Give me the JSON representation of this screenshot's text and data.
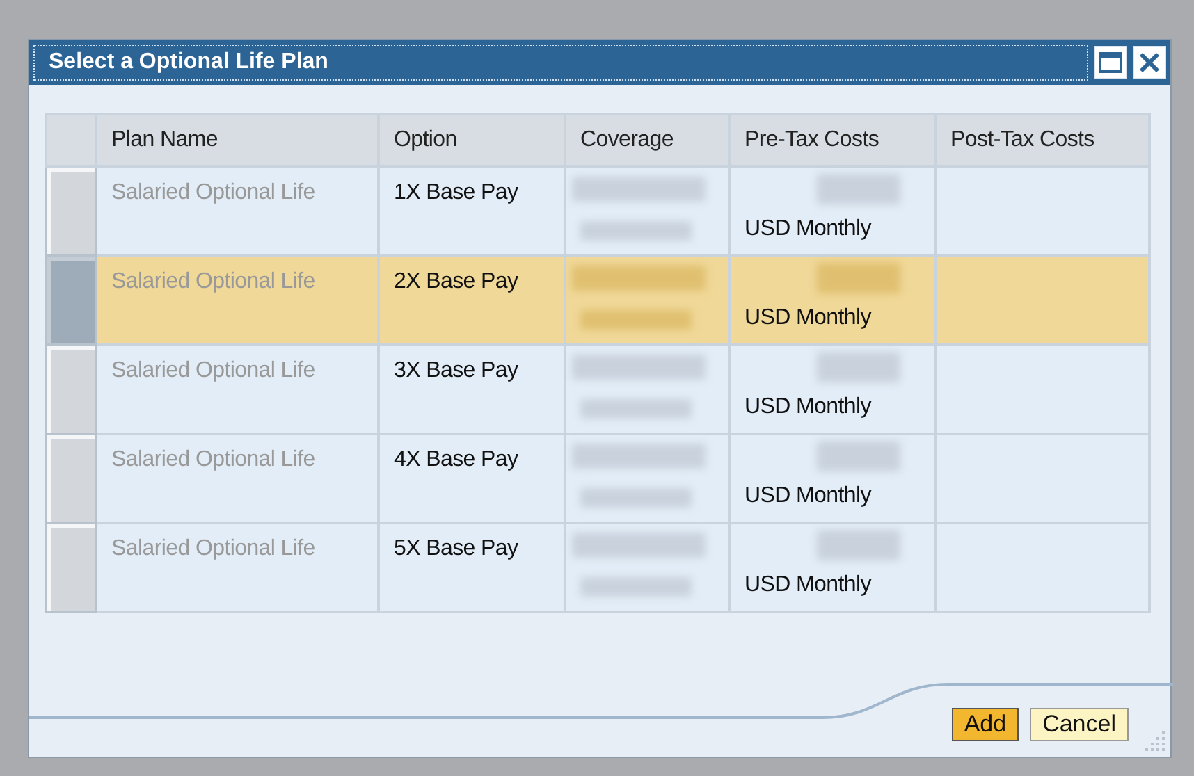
{
  "window": {
    "title": "Select a Optional Life Plan"
  },
  "table": {
    "columns": [
      "Plan Name",
      "Option",
      "Coverage",
      "Pre-Tax Costs",
      "Post-Tax Costs"
    ],
    "rows": [
      {
        "selected": false,
        "plan_name": "Salaried Optional Life",
        "plan_name_disabled": true,
        "option": "1X Base Pay",
        "pre_tax_unit": "USD Monthly"
      },
      {
        "selected": true,
        "plan_name": "Salaried Optional Life",
        "plan_name_disabled": true,
        "option": "2X Base Pay",
        "pre_tax_unit": "USD Monthly"
      },
      {
        "selected": false,
        "plan_name": "Salaried Optional Life",
        "plan_name_disabled": true,
        "option": "3X Base Pay",
        "pre_tax_unit": "USD Monthly"
      },
      {
        "selected": false,
        "plan_name": "Salaried Optional Life",
        "plan_name_disabled": true,
        "option": "4X Base Pay",
        "pre_tax_unit": "USD Monthly"
      },
      {
        "selected": false,
        "plan_name": "Salaried Optional Life",
        "plan_name_disabled": true,
        "option": "5X Base Pay",
        "pre_tax_unit": "USD Monthly"
      }
    ]
  },
  "buttons": [
    {
      "label": "Add",
      "kind": "primary"
    },
    {
      "label": "Cancel",
      "kind": "secondary"
    }
  ]
}
